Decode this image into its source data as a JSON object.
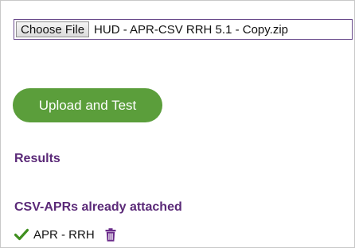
{
  "file_input": {
    "button_label": "Choose File",
    "file_name": "HUD - APR-CSV RRH 5.1 - Copy.zip"
  },
  "upload": {
    "label": "Upload and Test",
    "color": "#5b9e3b"
  },
  "results": {
    "heading": "Results"
  },
  "attached": {
    "heading": "CSV-APRs already attached",
    "items": [
      {
        "label": "APR - RRH",
        "status_icon": "check-icon",
        "action_icon": "trash-icon"
      }
    ]
  },
  "colors": {
    "heading": "#5b2a78",
    "check": "#3f8f1f",
    "trash": "#6a2b8a"
  }
}
